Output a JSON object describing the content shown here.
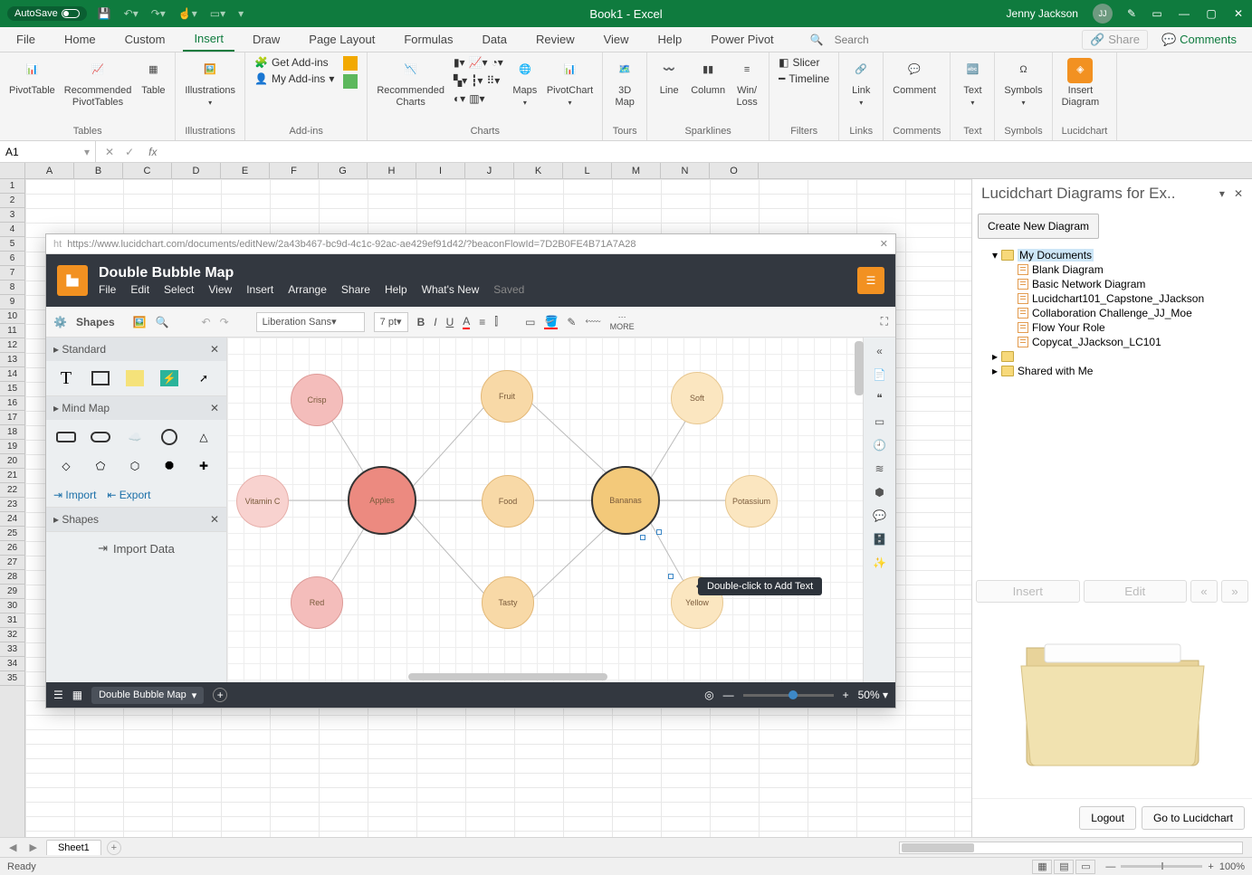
{
  "titlebar": {
    "autosave": "AutoSave",
    "title": "Book1 - Excel",
    "user": "Jenny Jackson",
    "initials": "JJ"
  },
  "tabs": [
    "File",
    "Home",
    "Custom",
    "Insert",
    "Draw",
    "Page Layout",
    "Formulas",
    "Data",
    "Review",
    "View",
    "Help",
    "Power Pivot"
  ],
  "active_tab_index": 3,
  "tabs_right": {
    "search": "Search",
    "share": "Share",
    "comments": "Comments"
  },
  "ribbon": {
    "tables": {
      "label": "Tables",
      "pivottable": "PivotTable",
      "recommended": "Recommended\nPivotTables",
      "table": "Table"
    },
    "illustrations": {
      "label": "Illustrations",
      "btn": "Illustrations"
    },
    "addins": {
      "label": "Add-ins",
      "get": "Get Add-ins",
      "my": "My Add-ins"
    },
    "charts": {
      "label": "Charts",
      "recommended": "Recommended\nCharts",
      "maps": "Maps",
      "pivotchart": "PivotChart"
    },
    "tours": {
      "label": "Tours",
      "map": "3D\nMap"
    },
    "sparklines": {
      "label": "Sparklines",
      "line": "Line",
      "column": "Column",
      "winloss": "Win/\nLoss"
    },
    "filters": {
      "label": "Filters",
      "slicer": "Slicer",
      "timeline": "Timeline"
    },
    "links": {
      "label": "Links",
      "link": "Link"
    },
    "comments": {
      "label": "Comments",
      "comment": "Comment"
    },
    "text": {
      "label": "Text",
      "btn": "Text"
    },
    "symbols": {
      "label": "Symbols",
      "btn": "Symbols"
    },
    "lucid": {
      "label": "Lucidchart",
      "btn": "Insert\nDiagram"
    }
  },
  "namebox": "A1",
  "columns": [
    "A",
    "B",
    "C",
    "D",
    "E",
    "F",
    "G",
    "H",
    "I",
    "J",
    "K",
    "L",
    "M",
    "N",
    "O"
  ],
  "rows": [
    "1",
    "2",
    "3",
    "4",
    "5",
    "6",
    "7",
    "8",
    "9",
    "10",
    "11",
    "12",
    "13",
    "14",
    "15",
    "16",
    "17",
    "18",
    "19",
    "20",
    "21",
    "22",
    "23",
    "24",
    "25",
    "26",
    "27",
    "28",
    "29",
    "30",
    "31",
    "32",
    "33",
    "34",
    "35"
  ],
  "taskpane": {
    "title": "Lucidchart Diagrams for Ex..",
    "newbtn": "Create New Diagram",
    "mydocs": "My Documents",
    "docs": [
      "Blank Diagram",
      "Basic Network Diagram",
      "Lucidchart101_Capstone_JJackson",
      "Collaboration Challenge_JJ_Moe",
      "Flow Your Role",
      "Copycat_JJackson_LC101"
    ],
    "shared": "Shared with Me",
    "insert": "Insert",
    "edit": "Edit",
    "logout": "Logout",
    "goto": "Go to Lucidchart"
  },
  "lucid": {
    "url": "https://www.lucidchart.com/documents/editNew/2a43b467-bc9d-4c1c-92ac-ae429ef91d42/?beaconFlowId=7D2B0FE4B71A7A28",
    "docname": "Double Bubble Map",
    "menus": [
      "File",
      "Edit",
      "Select",
      "View",
      "Insert",
      "Arrange",
      "Share",
      "Help",
      "What's New"
    ],
    "saved": "Saved",
    "shapes_label": "Shapes",
    "font": "Liberation Sans",
    "fontsize": "7 pt",
    "more": "MORE",
    "panel1": "Standard",
    "panel2": "Mind Map",
    "panel3": "Shapes",
    "import": "Import",
    "export": "Export",
    "importdata": "Import Data",
    "pagename": "Double Bubble Map",
    "zoom": "50%",
    "tooltip": "Double-click to Add Text",
    "bubbles": {
      "crisp": "Crisp",
      "fruit": "Fruit",
      "soft": "Soft",
      "vitaminc": "Vitamin C",
      "apples": "Apples",
      "food": "Food",
      "bananas": "Bananas",
      "potassium": "Potassium",
      "red": "Red",
      "tasty": "Tasty",
      "yellow": "Yellow"
    }
  },
  "sheet": "Sheet1",
  "status": "Ready",
  "zoom": "100%"
}
